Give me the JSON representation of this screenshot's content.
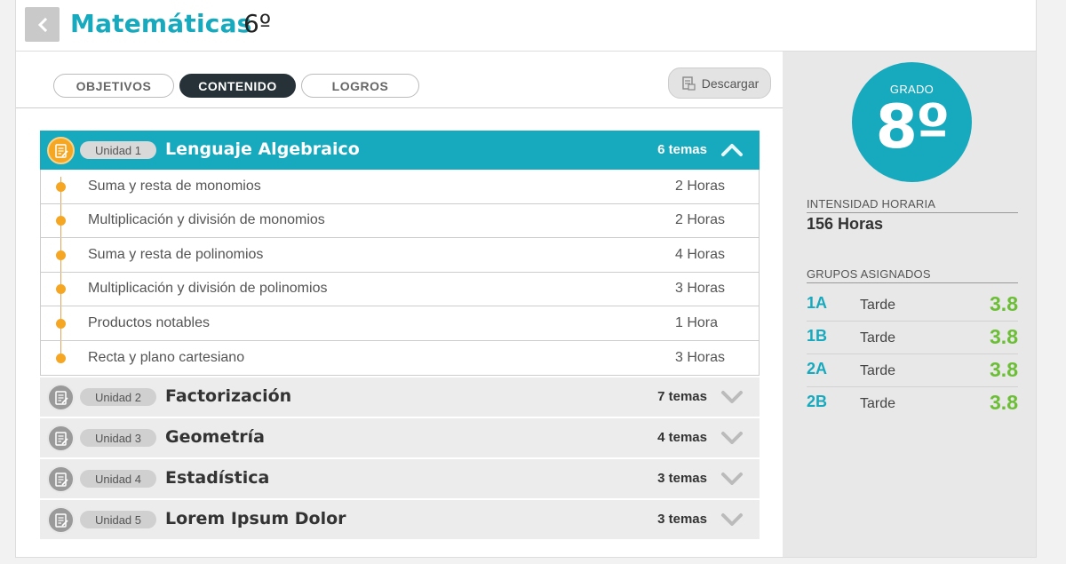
{
  "header": {
    "title": "Matemáticas",
    "grade": "6º",
    "back_icon": "chevron-left-icon"
  },
  "tabs": [
    {
      "label": "OBJETIVOS",
      "active": false
    },
    {
      "label": "CONTENIDO",
      "active": true
    },
    {
      "label": "LOGROS",
      "active": false
    }
  ],
  "download": {
    "label": "Descargar",
    "icon": "document-download-icon"
  },
  "units": [
    {
      "badge": "Unidad 1",
      "name": "Lenguaje Algebraico",
      "count": "6 temas",
      "expanded": true,
      "topics": [
        {
          "name": "Suma y resta de monomios",
          "hours": "2 Horas"
        },
        {
          "name": "Multiplicación y división de monomios",
          "hours": "2 Horas"
        },
        {
          "name": "Suma y resta de polinomios",
          "hours": "4 Horas"
        },
        {
          "name": "Multiplicación y división de polinomios",
          "hours": "3 Horas"
        },
        {
          "name": "Productos notables",
          "hours": "1 Hora"
        },
        {
          "name": "Recta y plano cartesiano",
          "hours": "3 Horas"
        }
      ]
    },
    {
      "badge": "Unidad 2",
      "name": "Factorización",
      "count": "7 temas",
      "expanded": false
    },
    {
      "badge": "Unidad 3",
      "name": "Geometría",
      "count": "4 temas",
      "expanded": false
    },
    {
      "badge": "Unidad 4",
      "name": "Estadística",
      "count": "3 temas",
      "expanded": false
    },
    {
      "badge": "Unidad 5",
      "name": "Lorem Ipsum Dolor",
      "count": "3 temas",
      "expanded": false
    }
  ],
  "sidebar": {
    "grade_label": "GRADO",
    "grade_value": "8º",
    "intensity_label": "INTENSIDAD HORARIA",
    "intensity_value": "156 Horas",
    "groups_label": "GRUPOS ASIGNADOS",
    "groups": [
      {
        "name": "1A",
        "shift": "Tarde",
        "score": "3.8"
      },
      {
        "name": "1B",
        "shift": "Tarde",
        "score": "3.8"
      },
      {
        "name": "2A",
        "shift": "Tarde",
        "score": "3.8"
      },
      {
        "name": "2B",
        "shift": "Tarde",
        "score": "3.8"
      }
    ]
  },
  "colors": {
    "accent": "#17a9bd",
    "orange": "#f5a623",
    "green": "#6bbe35",
    "dark": "#263238"
  }
}
